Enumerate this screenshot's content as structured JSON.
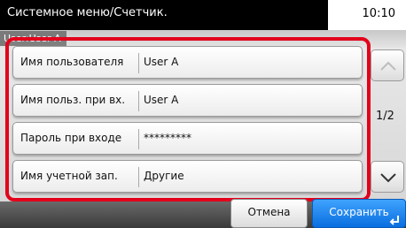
{
  "header": {
    "title": "Системное меню/Счетчик.",
    "time": "10:10",
    "user": "User:User A"
  },
  "rows": [
    {
      "label": "Имя пользователя",
      "value": "User A"
    },
    {
      "label": "Имя польз. при вх.",
      "value": "User A"
    },
    {
      "label": "Пароль при входе",
      "value": "*********"
    },
    {
      "label": "Имя учетной зап.",
      "value": "Другие"
    }
  ],
  "pager": {
    "indicator": "1/2"
  },
  "footer": {
    "cancel_label": "Отмена",
    "save_label": "Сохранить"
  },
  "colors": {
    "highlight": "#e3001b",
    "save": "#1e88f0"
  },
  "icons": {
    "up": "chevron-up-icon",
    "down": "chevron-down-icon",
    "enter": "enter-icon"
  }
}
